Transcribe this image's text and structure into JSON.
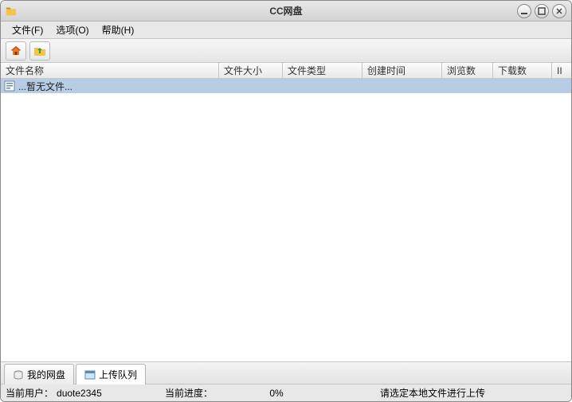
{
  "window": {
    "title": "CC网盘"
  },
  "menubar": [
    {
      "label": "文件(F)"
    },
    {
      "label": "选项(O)"
    },
    {
      "label": "帮助(H)"
    }
  ],
  "columns": {
    "name": "文件名称",
    "size": "文件大小",
    "type": "文件类型",
    "created": "创建时间",
    "views": "浏览数",
    "downloads": "下载数",
    "extra": "II"
  },
  "rows": {
    "empty": "...暂无文件..."
  },
  "tabs": {
    "mydisk": "我的网盘",
    "uploadqueue": "上传队列"
  },
  "status": {
    "user_label": "当前用户：",
    "user_value": "duote2345",
    "progress_label": "当前进度：",
    "progress_value": "0%",
    "hint": "请选定本地文件进行上传"
  },
  "colwidths": {
    "name": "274px",
    "size": "80px",
    "type": "100px",
    "created": "100px",
    "views": "64px",
    "downloads": "74px",
    "extra": "20px"
  }
}
